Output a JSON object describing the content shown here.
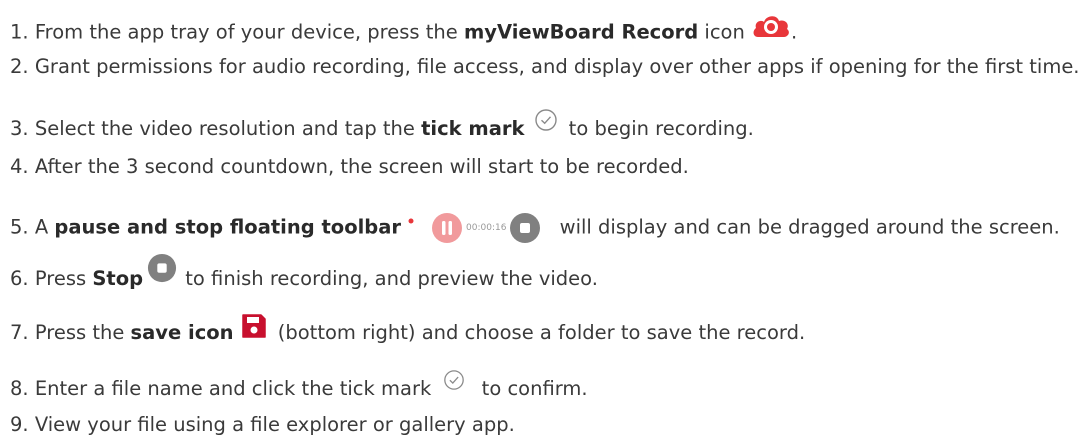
{
  "steps": [
    {
      "num": "1.",
      "t1": "From the app tray of your device, press the ",
      "b1": "myViewBoard Record",
      "t2": " icon ",
      "t3": "."
    },
    {
      "num": "2.",
      "t1": "Grant permissions for audio recording, file access, and display over other apps if opening for the first time."
    },
    {
      "num": "3.",
      "t1": "Select the video resolution and tap the ",
      "b1": "tick mark",
      "t2": " to begin recording."
    },
    {
      "num": "4.",
      "t1": "After the 3 second countdown, the screen will start to be recorded."
    },
    {
      "num": "5.",
      "t1": "A ",
      "b1": "pause and stop floating toolbar",
      "t2": " will display and can be dragged around the screen.",
      "timer": "00:00:16"
    },
    {
      "num": "6.",
      "t1": "Press ",
      "b1": "Stop",
      "t2": " to finish recording, and preview the video."
    },
    {
      "num": "7.",
      "t1": "Press the ",
      "b1": "save icon",
      "t2": " (bottom right) and choose a folder to save the record."
    },
    {
      "num": "8.",
      "t1": "Enter a file name and click the tick mark ",
      "t2": " to confirm."
    },
    {
      "num": "9.",
      "t1": "View your file using a file explorer or gallery app."
    }
  ],
  "colors": {
    "record_red": "#e8363a",
    "save_red": "#c8102e",
    "stop_gray": "#808080",
    "pause_pink": "#f19a9c",
    "tick_gray": "#8a8a8a"
  }
}
